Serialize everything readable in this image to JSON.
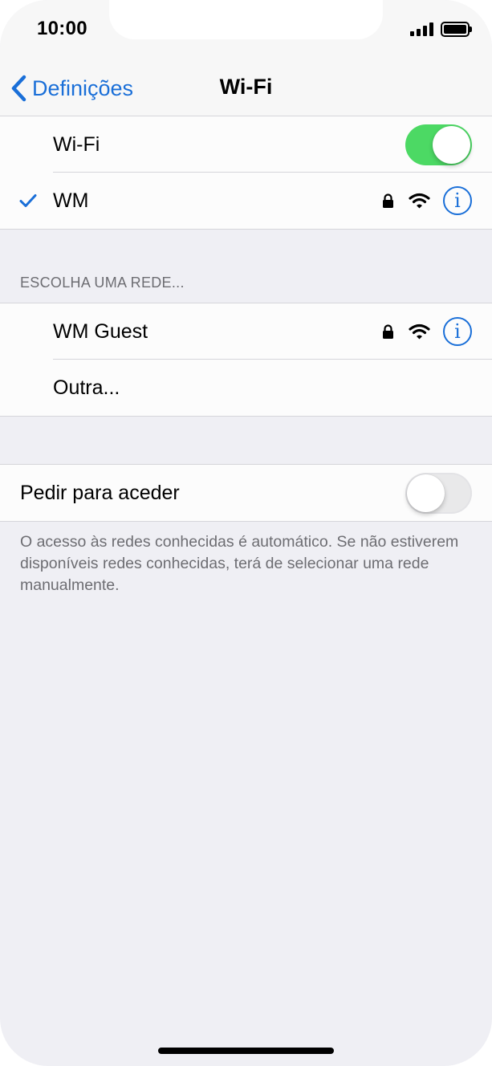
{
  "status_bar": {
    "time": "10:00"
  },
  "nav": {
    "back_label": "Definições",
    "title": "Wi-Fi"
  },
  "wifi_group": {
    "wifi_toggle": {
      "label": "Wi-Fi",
      "state": "on"
    },
    "connected_network": {
      "name": "WM",
      "secured": true,
      "checked": true
    }
  },
  "networks": {
    "header": "ESCOLHA UMA REDE...",
    "items": [
      {
        "name": "WM Guest",
        "secured": true
      },
      {
        "name": "Outra..."
      }
    ]
  },
  "ask_to_join": {
    "label": "Pedir para aceder",
    "state": "off",
    "footer": "O acesso às redes conhecidas é automático. Se não estiverem disponíveis redes conhecidas, terá de selecionar uma rede manualmente."
  },
  "icons": {
    "back": "chevron-left-icon",
    "check": "checkmark-icon",
    "lock": "lock-icon",
    "wifi": "wifi-signal-icon",
    "info": "info-icon"
  },
  "colors": {
    "accent": "#1a6fd8",
    "toggle_on": "#4cd964",
    "background": "#efeff4"
  }
}
